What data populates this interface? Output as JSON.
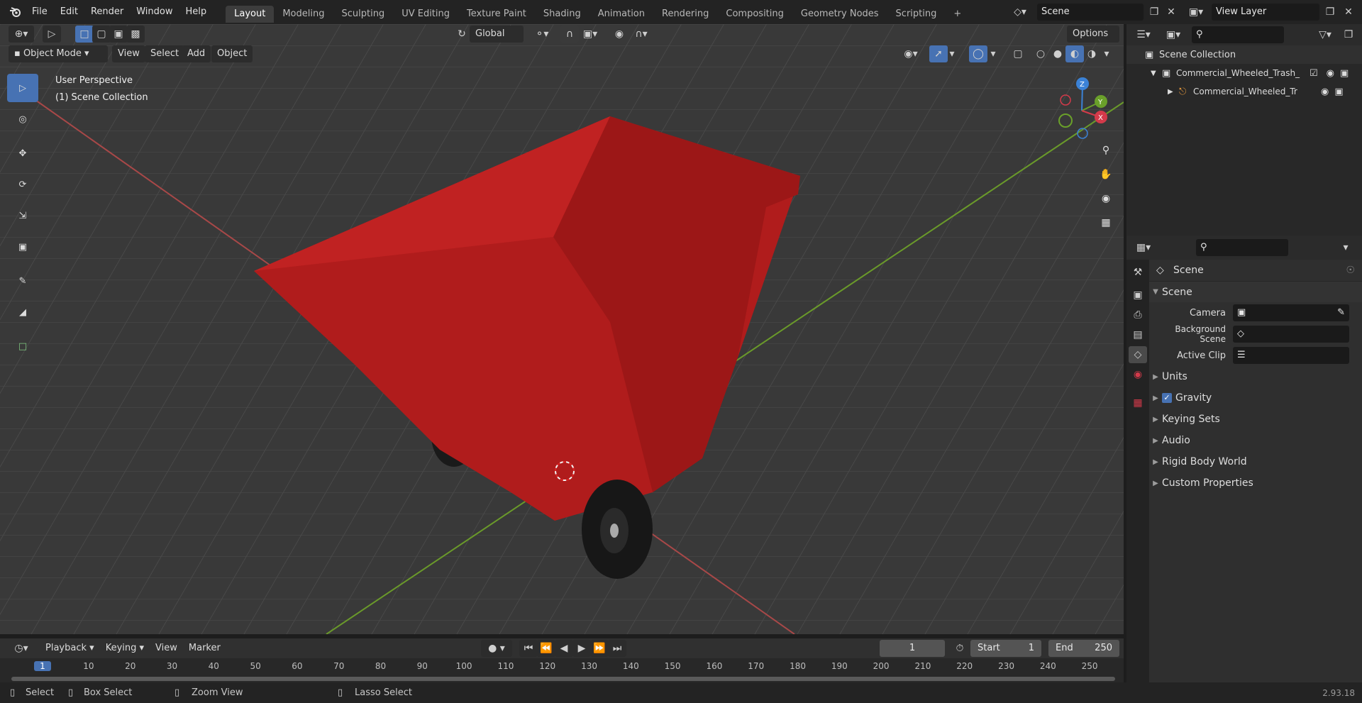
{
  "menubar": {
    "items": [
      "File",
      "Edit",
      "Render",
      "Window",
      "Help"
    ]
  },
  "workspaces": [
    "Layout",
    "Modeling",
    "Sculpting",
    "UV Editing",
    "Texture Paint",
    "Shading",
    "Animation",
    "Rendering",
    "Compositing",
    "Geometry Nodes",
    "Scripting"
  ],
  "scene_field": "Scene",
  "view_layer_field": "View Layer",
  "header": {
    "transform_orientation": "Global",
    "options": "Options",
    "mode": "Object Mode",
    "menus": [
      "View",
      "Select",
      "Add",
      "Object"
    ]
  },
  "viewport": {
    "perspective": "User Perspective",
    "collection": "(1) Scene Collection"
  },
  "outliner": {
    "root": "Scene Collection",
    "items": [
      "Commercial_Wheeled_Trash_",
      "Commercial_Wheeled_Tr"
    ]
  },
  "properties": {
    "context": "Scene",
    "panel_title": "Scene",
    "rows": [
      {
        "label": "Camera",
        "value": ""
      },
      {
        "label": "Background Scene",
        "value": ""
      },
      {
        "label": "Active Clip",
        "value": ""
      }
    ],
    "subpanels": [
      "Units",
      "Gravity",
      "Keying Sets",
      "Audio",
      "Rigid Body World",
      "Custom Properties"
    ]
  },
  "timeline": {
    "menus": [
      "Playback",
      "Keying",
      "View",
      "Marker"
    ],
    "current_frame": "1",
    "start_label": "Start",
    "start": "1",
    "end_label": "End",
    "end": "250",
    "ticks": [
      "1",
      "10",
      "20",
      "30",
      "40",
      "50",
      "60",
      "70",
      "80",
      "90",
      "100",
      "110",
      "120",
      "130",
      "140",
      "150",
      "160",
      "170",
      "180",
      "190",
      "200",
      "210",
      "220",
      "230",
      "240",
      "250"
    ]
  },
  "status": {
    "select": "Select",
    "box_select": "Box Select",
    "zoom_view": "Zoom View",
    "lasso": "Lasso Select",
    "version": "2.93.18"
  },
  "colors": {
    "bin_red": "#b01c1c",
    "accent": "#4772b3"
  }
}
